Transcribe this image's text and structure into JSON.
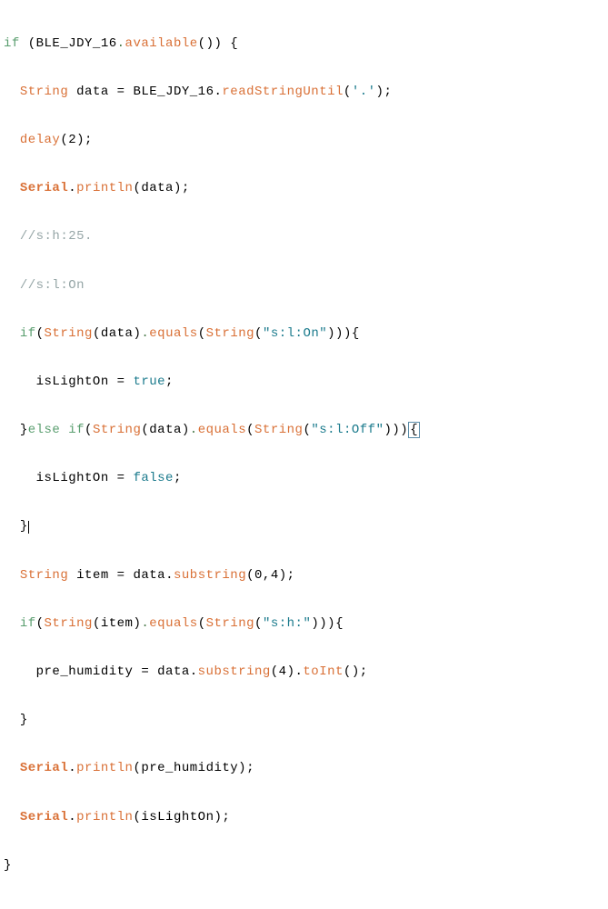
{
  "code": {
    "line1": {
      "kw_if": "if",
      "obj": "BLE_JDY_16",
      "dot": ".",
      "func": "available",
      "parens": "()",
      "brace": " {"
    },
    "line2": {
      "type": "String",
      "var": " data ",
      "op": "= ",
      "obj": "BLE_JDY_16",
      "dot": ".",
      "func": "readStringUntil",
      "lparen": "(",
      "char": "'.'",
      "rparen": ");"
    },
    "line3": {
      "func": "delay",
      "args": "(2);"
    },
    "line4": {
      "obj": "Serial",
      "dot": ".",
      "func": "println",
      "args": "(data);"
    },
    "line5": {
      "comment": "//s:h:25."
    },
    "line6": {
      "comment": "//s:l:On"
    },
    "line7": {
      "kw_if": "if",
      "lparen": "(",
      "type1": "String",
      "args1": "(data)",
      "dot1": ".",
      "func1": "equals",
      "lparen2": "(",
      "type2": "String",
      "lparen3": "(",
      "str": "\"s:l:On\"",
      "rparen": "))){"
    },
    "line8": {
      "var": "isLightOn ",
      "op": "= ",
      "bool": "true",
      "semi": ";"
    },
    "line9": {
      "brace1": "}",
      "kw_else": "else",
      "sp": " ",
      "kw_if": "if",
      "lparen": "(",
      "type1": "String",
      "args1": "(data)",
      "dot1": ".",
      "func1": "equals",
      "lparen2": "(",
      "type2": "String",
      "lparen3": "(",
      "str": "\"s:l:Off\"",
      "rparen": ")))",
      "boxed": "{"
    },
    "line10": {
      "var": "isLightOn ",
      "op": "= ",
      "bool": "false",
      "semi": ";"
    },
    "line11": {
      "brace": "}"
    },
    "line12": {
      "type": "String",
      "var": " item ",
      "op": "= ",
      "obj": "data",
      "dot": ".",
      "func": "substring",
      "args": "(0,4);"
    },
    "line13": {
      "kw_if": "if",
      "lparen": "(",
      "type1": "String",
      "args1": "(item)",
      "dot1": ".",
      "func1": "equals",
      "lparen2": "(",
      "type2": "String",
      "lparen3": "(",
      "str": "\"s:h:\"",
      "rparen": "))){"
    },
    "line14": {
      "var": "pre_humidity ",
      "op": "= ",
      "obj": "data",
      "dot": ".",
      "func": "substring",
      "args1": "(4)",
      "dot2": ".",
      "func2": "toInt",
      "args2": "();"
    },
    "line15": {
      "brace": "}"
    },
    "line16": {
      "obj": "Serial",
      "dot": ".",
      "func": "println",
      "args": "(pre_humidity);"
    },
    "line17": {
      "obj": "Serial",
      "dot": ".",
      "func": "println",
      "args": "(isLightOn);"
    },
    "line18": {
      "brace": "}"
    }
  }
}
